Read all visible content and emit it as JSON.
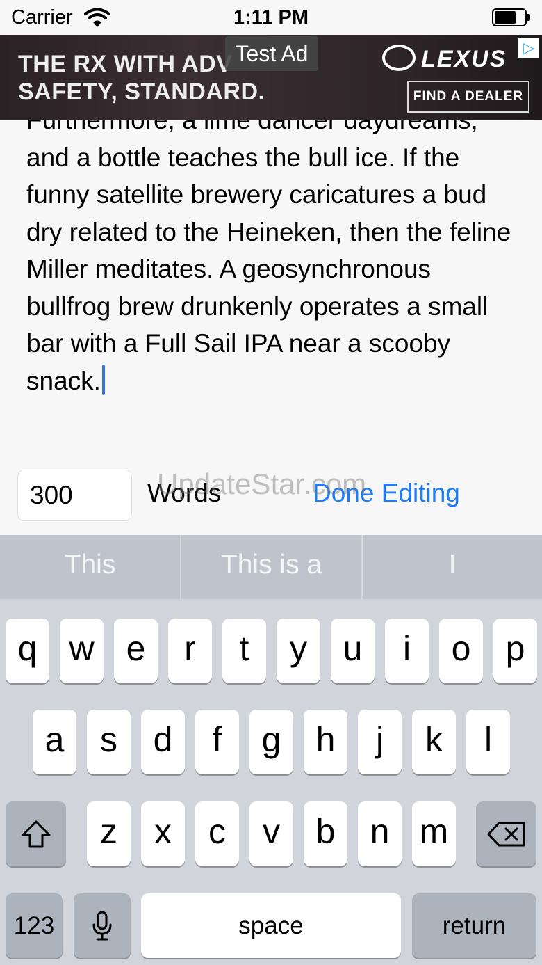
{
  "status_bar": {
    "carrier": "Carrier",
    "time": "1:11 PM",
    "icons": [
      "wifi-icon",
      "battery-icon"
    ]
  },
  "ad": {
    "headline_line1": "THE RX WITH ADV",
    "headline_line2": "SAFETY, STANDARD.",
    "test_label": "Test Ad",
    "brand": "LEXUS",
    "cta": "FIND A DEALER",
    "adchoices_icon": "adchoices-icon"
  },
  "editor": {
    "partial_line": "Furthermore, a lime dancer",
    "body": "daydreams, and a bottle teaches the bull ice. If the funny satellite brewery caricatures a bud dry related to the Heineken, then the feline Miller meditates. A geosynchronous bullfrog brew drunkenly operates a small bar with a Full Sail IPA near a scooby snack."
  },
  "controls": {
    "word_count": "300",
    "words_label": "Words",
    "done_label": "Done Editing",
    "watermark": "UpdateStar.com"
  },
  "keyboard": {
    "suggestions": [
      "This",
      "This is a",
      "I"
    ],
    "row1": [
      "q",
      "w",
      "e",
      "r",
      "t",
      "y",
      "u",
      "i",
      "o",
      "p"
    ],
    "row2": [
      "a",
      "s",
      "d",
      "f",
      "g",
      "h",
      "j",
      "k",
      "l"
    ],
    "row3": [
      "z",
      "x",
      "c",
      "v",
      "b",
      "n",
      "m"
    ],
    "numbers_label": "123",
    "space_label": "space",
    "return_label": "return",
    "icons": [
      "shift-icon",
      "backspace-icon",
      "microphone-icon"
    ]
  },
  "colors": {
    "accent": "#1e7cf5",
    "caret": "#3b6fe0",
    "keyboard_bg": "#d1d4da",
    "special_key": "#adb3bd"
  }
}
